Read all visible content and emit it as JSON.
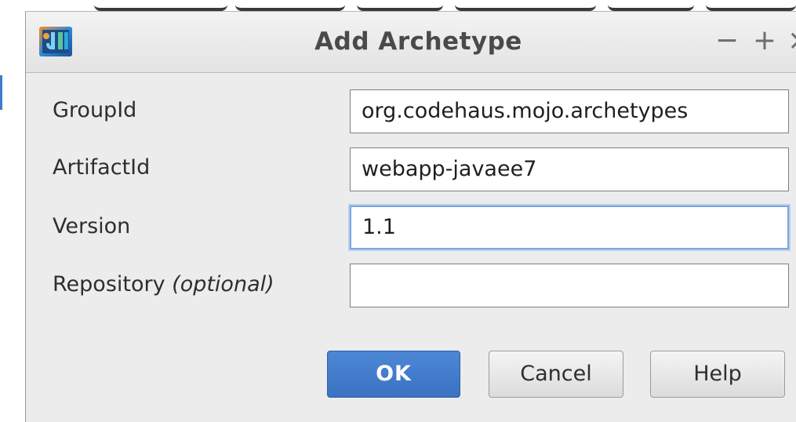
{
  "window": {
    "title": "Add Archetype",
    "controls": {
      "minimize": "−",
      "maximize": "+",
      "close": "×"
    }
  },
  "form": {
    "group_id": {
      "label": "GroupId",
      "value": "org.codehaus.mojo.archetypes"
    },
    "artifact_id": {
      "label": "ArtifactId",
      "value": "webapp-javaee7"
    },
    "version": {
      "label": "Version",
      "value": "1.1"
    },
    "repository": {
      "label": "Repository ",
      "label_suffix": "(optional)",
      "value": ""
    }
  },
  "buttons": {
    "ok": "OK",
    "cancel": "Cancel",
    "help": "Help"
  },
  "colors": {
    "accent": "#3b72c2",
    "focus_ring": "#7aa6dc",
    "dialog_bg": "#ececec"
  },
  "icons": {
    "app": "intellij-idea-icon"
  }
}
